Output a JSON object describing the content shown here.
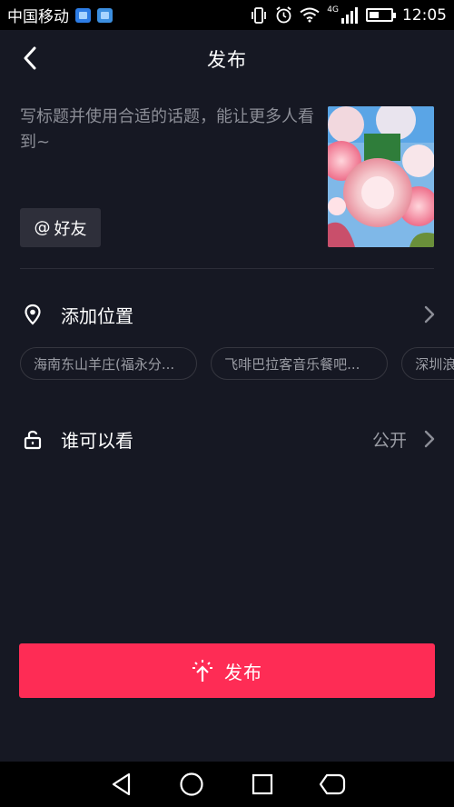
{
  "status_bar": {
    "carrier": "中国移动",
    "network": "4G",
    "time": "12:05",
    "battery_level": 0.45
  },
  "header": {
    "title": "发布"
  },
  "caption": {
    "placeholder": "写标题并使用合适的话题，能让更多人看到~"
  },
  "mention": {
    "symbol": "@",
    "label": "好友"
  },
  "location": {
    "label": "添加位置",
    "suggestions": [
      "海南东山羊庄(福永分...",
      "飞啡巴拉客音乐餐吧...",
      "深圳浪"
    ]
  },
  "privacy": {
    "label": "谁可以看",
    "value": "公开"
  },
  "publish": {
    "label": "发布"
  },
  "colors": {
    "background": "#161823",
    "accent": "#fe2c55",
    "secondary_text": "#8c8e97"
  }
}
